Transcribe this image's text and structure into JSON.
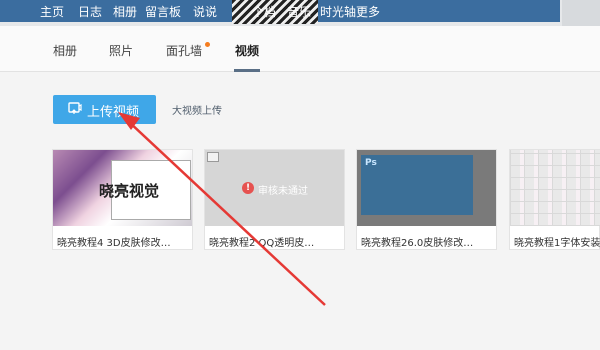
{
  "topnav": {
    "items": [
      "主页",
      "日志",
      "相册",
      "留言板",
      "说说",
      "个档",
      "音乐",
      "时光轴",
      "更多"
    ]
  },
  "tabs": [
    {
      "label": "相册",
      "active": false
    },
    {
      "label": "照片",
      "active": false
    },
    {
      "label": "面孔墙",
      "active": false
    },
    {
      "label": "视频",
      "active": true
    }
  ],
  "upload": {
    "button_label": "上传视频",
    "large_upload_label": "大视频上传"
  },
  "videos": [
    {
      "title": "晓亮教程4 3D皮肤修改…",
      "thumb_text": "晓亮视觉"
    },
    {
      "title": "晓亮教程2 QQ透明皮…",
      "status": "审核未通过"
    },
    {
      "title": "晓亮教程26.0皮肤修改…",
      "thumb_text": "Ps"
    },
    {
      "title": "晓亮教程1字体安装…"
    }
  ],
  "colors": {
    "primary_button": "#3fa7e8",
    "nav_bar": "#3b6d9f",
    "arrow": "#e53935",
    "notification_dot": "#f57d1f"
  }
}
